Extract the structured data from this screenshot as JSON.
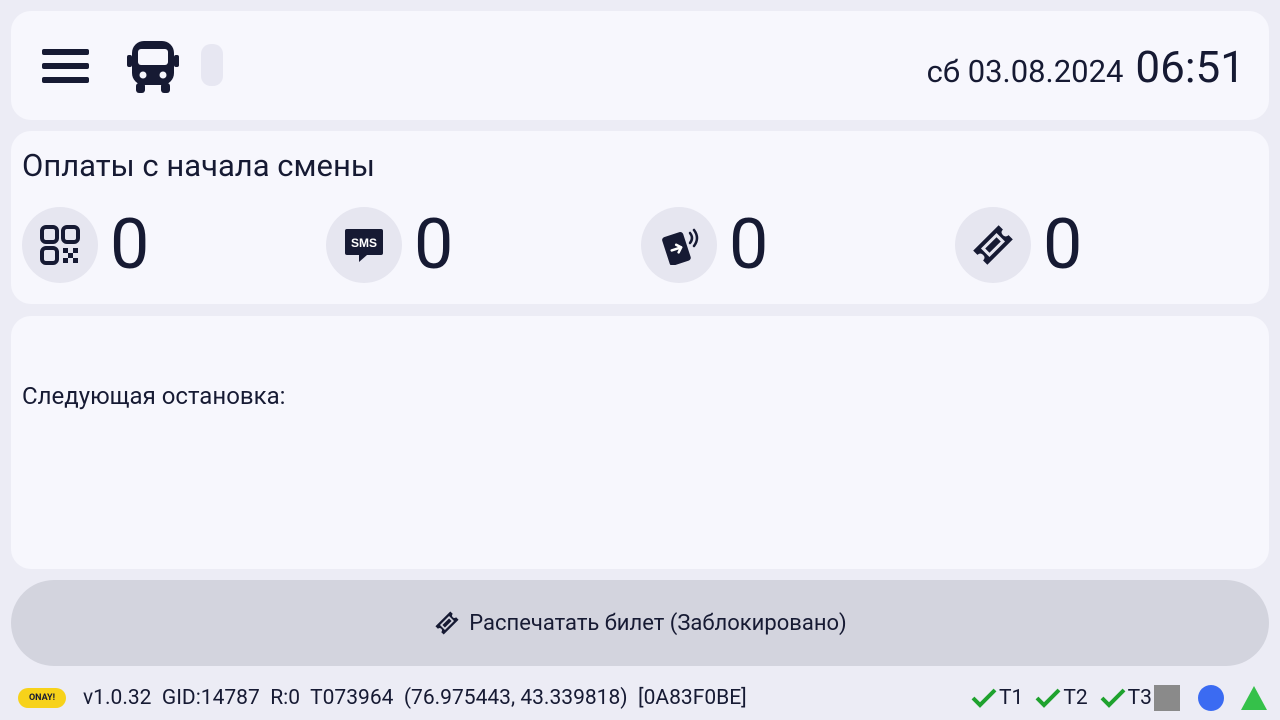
{
  "header": {
    "date": "сб 03.08.2024",
    "time": "06:51",
    "menu_icon": "hamburger-menu-icon",
    "vehicle_icon": "bus-icon"
  },
  "payments": {
    "title": "Оплаты с начала смены",
    "items": [
      {
        "icon": "qr-code-icon",
        "count": "0"
      },
      {
        "icon": "sms-icon",
        "count": "0"
      },
      {
        "icon": "card-tap-icon",
        "count": "0"
      },
      {
        "icon": "ticket-icon",
        "count": "0"
      }
    ]
  },
  "next_stop": {
    "label": "Следующая остановка:"
  },
  "print_button": {
    "label": "Распечатать билет (Заблокировано)"
  },
  "status_bar": {
    "logo_text": "ONAY!",
    "version": "v1.0.32",
    "gid": "GID:14787",
    "r": "R:0",
    "terminal": "T073964",
    "coords": "(76.975443, 43.339818)",
    "hex_id": "[0A83F0BE]",
    "indicators": [
      "T1",
      "T2",
      "T3"
    ],
    "colors": {
      "check": "#1fa22e",
      "square": "#8a8a8a",
      "circle": "#3b6bf2",
      "triangle": "#35c14a"
    }
  }
}
